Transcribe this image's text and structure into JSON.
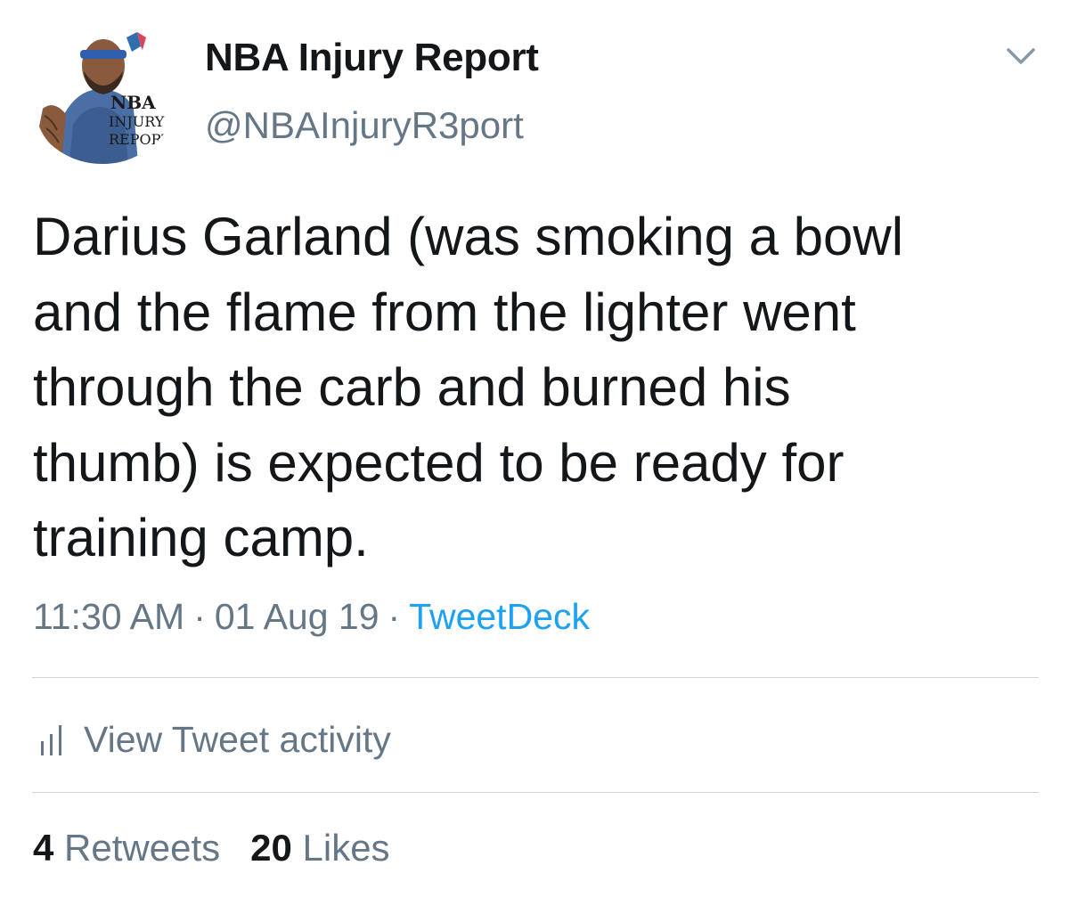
{
  "account": {
    "display_name": "NBA Injury Report",
    "handle": "@NBAInjuryR3port",
    "avatar_lettering": [
      "NBA",
      "INJURY",
      "REPORT"
    ]
  },
  "tweet": {
    "text": "Darius Garland (was smoking a bowl\nand the flame from the lighter  went\nthrough the carb and burned his\nthumb) is expected to be ready for\ntraining camp.",
    "time": "11:30 AM",
    "separator": "·",
    "date": "01 Aug 19",
    "source": "TweetDeck"
  },
  "activity": {
    "label": "View Tweet activity",
    "icon": "bar-chart-icon"
  },
  "stats": {
    "retweets_count": "4",
    "retweets_label": "Retweets",
    "likes_count": "20",
    "likes_label": "Likes"
  },
  "colors": {
    "text": "#14171a",
    "secondary": "#657786",
    "link": "#1da1f2",
    "divider": "#ccd6dd"
  },
  "icons": {
    "menu": "chevron-down-icon"
  }
}
